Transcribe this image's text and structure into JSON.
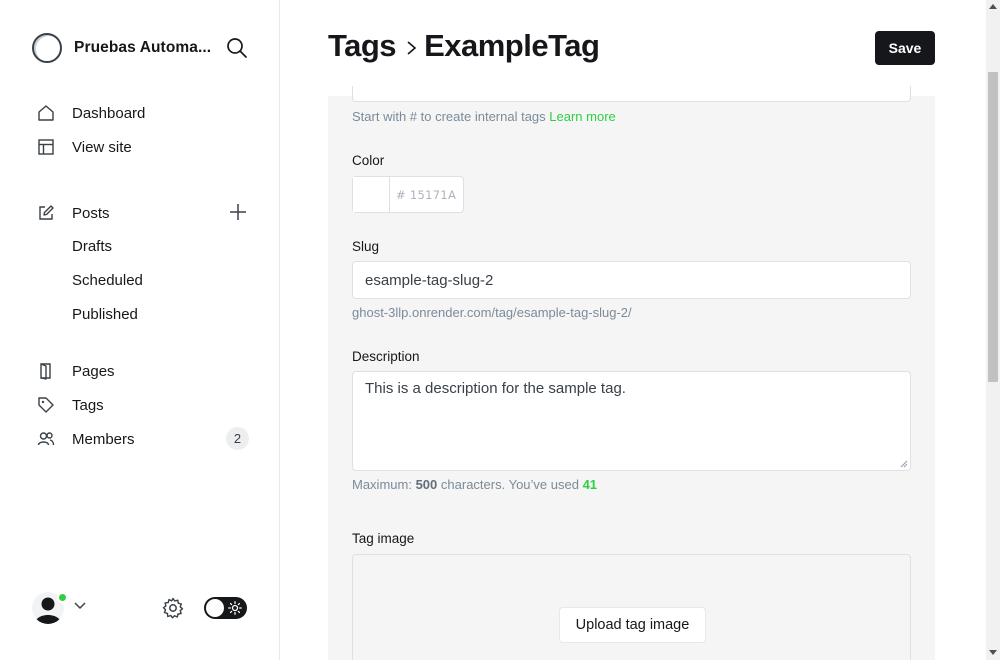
{
  "sidebar": {
    "site_name": "Pruebas Automa...",
    "nav": {
      "dashboard": "Dashboard",
      "view_site": "View site",
      "posts": "Posts",
      "drafts": "Drafts",
      "scheduled": "Scheduled",
      "published": "Published",
      "pages": "Pages",
      "tags": "Tags",
      "members": "Members",
      "members_count": "2"
    }
  },
  "header": {
    "breadcrumb_parent": "Tags",
    "breadcrumb_separator": "›",
    "breadcrumb_current": "ExampleTag",
    "save_label": "Save"
  },
  "form": {
    "name_hint": "Start with # to create internal tags",
    "learn_more": "Learn more",
    "color_label": "Color",
    "color_hex_prefix": "#",
    "color_value": "15171A",
    "slug_label": "Slug",
    "slug_value": "esample-tag-slug-2",
    "slug_url": "ghost-3llp.onrender.com/tag/esample-tag-slug-2/",
    "description_label": "Description",
    "description_value": "This is a description for the sample tag.",
    "desc_hint_prefix": "Maximum:",
    "desc_max": "500",
    "desc_hint_middle": "characters. You’ve used",
    "desc_used": "41",
    "tag_image_label": "Tag image",
    "upload_label": "Upload tag image"
  },
  "colors": {
    "accent": "#30cf43",
    "primary": "#15171a",
    "panel_bg": "#f4f5f4"
  }
}
